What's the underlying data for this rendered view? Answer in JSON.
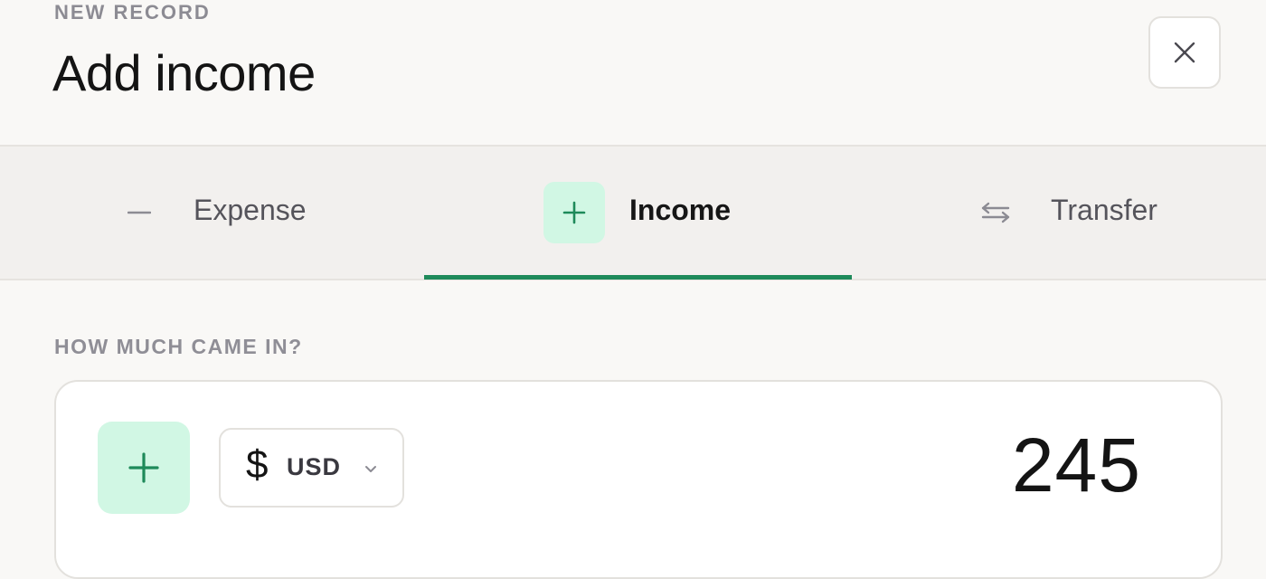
{
  "header": {
    "overline": "NEW RECORD",
    "title": "Add income",
    "close_icon": "close-icon"
  },
  "tabs": [
    {
      "label": "Expense",
      "icon": "minus-icon",
      "selected": false
    },
    {
      "label": "Income",
      "icon": "plus-icon",
      "selected": true
    },
    {
      "label": "Transfer",
      "icon": "transfer-arrows-icon",
      "selected": false
    }
  ],
  "amount_section": {
    "label": "HOW MUCH CAME IN?",
    "sign_icon": "plus-icon",
    "currency": {
      "symbol": "$",
      "code": "USD",
      "icon": "chevron-down-icon"
    },
    "value": "245"
  },
  "colors": {
    "accent": "#1e8a5a",
    "accent_soft": "#d1f7e4",
    "background": "#f9f8f6",
    "tab_bar": "#f2f0ee",
    "border": "#e3e1dd"
  }
}
